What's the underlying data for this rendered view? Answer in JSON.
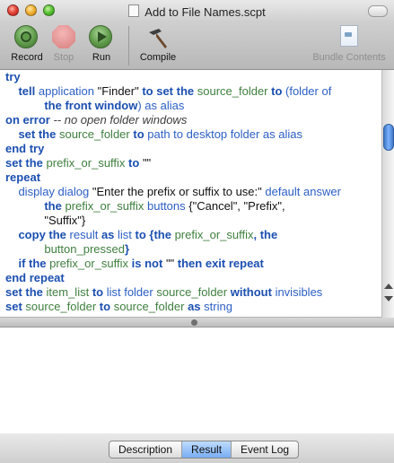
{
  "window": {
    "title": "Add to File Names.scpt"
  },
  "toolbar": {
    "record_label": "Record",
    "stop_label": "Stop",
    "run_label": "Run",
    "compile_label": "Compile",
    "bundle_label": "Bundle Contents"
  },
  "editor": {
    "lines": [
      [
        [
          "try",
          "kw"
        ]
      ],
      [
        [
          "    ",
          ""
        ],
        [
          "tell",
          "kw"
        ],
        [
          " application ",
          "ap"
        ],
        [
          "\"Finder\"",
          "str"
        ],
        [
          " to set the ",
          "kw"
        ],
        [
          "source_folder",
          "var"
        ],
        [
          " to ",
          "kw"
        ],
        [
          "(folder of",
          "ap"
        ]
      ],
      [
        [
          "            ",
          ""
        ],
        [
          "the front window",
          "kw"
        ],
        [
          ") as alias",
          "ap"
        ]
      ],
      [
        [
          "on error",
          "kw"
        ],
        [
          " -- no open folder windows",
          "cmt"
        ]
      ],
      [
        [
          "    ",
          ""
        ],
        [
          "set the ",
          "kw"
        ],
        [
          "source_folder",
          "var"
        ],
        [
          " to ",
          "kw"
        ],
        [
          "path to desktop folder as alias",
          "ap"
        ]
      ],
      [
        [
          "end try",
          "kw"
        ]
      ],
      [
        [
          "",
          ""
        ]
      ],
      [
        [
          "set the ",
          "kw"
        ],
        [
          "prefix_or_suffix",
          "var"
        ],
        [
          " to ",
          "kw"
        ],
        [
          "\"\"",
          "str"
        ]
      ],
      [
        [
          "repeat",
          "kw"
        ]
      ],
      [
        [
          "    ",
          ""
        ],
        [
          "display dialog ",
          "ap"
        ],
        [
          "\"Enter the prefix or suffix to use:\"",
          "str"
        ],
        [
          " default answer",
          "ap"
        ]
      ],
      [
        [
          "            ",
          ""
        ],
        [
          "the ",
          "kw"
        ],
        [
          "prefix_or_suffix",
          "var"
        ],
        [
          " buttons ",
          "ap"
        ],
        [
          "{\"Cancel\", \"Prefix\",",
          "str"
        ]
      ],
      [
        [
          "            ",
          ""
        ],
        [
          "\"Suffix\"}",
          "str"
        ]
      ],
      [
        [
          "    ",
          ""
        ],
        [
          "copy the ",
          "kw"
        ],
        [
          "result",
          "ap"
        ],
        [
          " as ",
          "kw"
        ],
        [
          "list",
          "ap"
        ],
        [
          " to ",
          "kw"
        ],
        [
          "{the ",
          "kw"
        ],
        [
          "prefix_or_suffix",
          "var"
        ],
        [
          ", the",
          "kw"
        ]
      ],
      [
        [
          "            ",
          ""
        ],
        [
          "button_pressed",
          "var"
        ],
        [
          "}",
          "kw"
        ]
      ],
      [
        [
          "    ",
          ""
        ],
        [
          "if the ",
          "kw"
        ],
        [
          "prefix_or_suffix",
          "var"
        ],
        [
          " is not ",
          "kw"
        ],
        [
          "\"\"",
          "str"
        ],
        [
          " then exit repeat",
          "kw"
        ]
      ],
      [
        [
          "end repeat",
          "kw"
        ]
      ],
      [
        [
          "set the ",
          "kw"
        ],
        [
          "item_list",
          "var"
        ],
        [
          " to ",
          "kw"
        ],
        [
          "list folder ",
          "ap"
        ],
        [
          "source_folder",
          "var"
        ],
        [
          " without ",
          "kw"
        ],
        [
          "invisibles",
          "ap"
        ]
      ],
      [
        [
          "set ",
          "kw"
        ],
        [
          "source_folder",
          "var"
        ],
        [
          " to ",
          "kw"
        ],
        [
          "source_folder",
          "var"
        ],
        [
          " as ",
          "kw"
        ],
        [
          "string",
          "ap"
        ]
      ]
    ]
  },
  "bottom_tabs": {
    "description": "Description",
    "result": "Result",
    "event_log": "Event Log",
    "selected": "Result"
  }
}
